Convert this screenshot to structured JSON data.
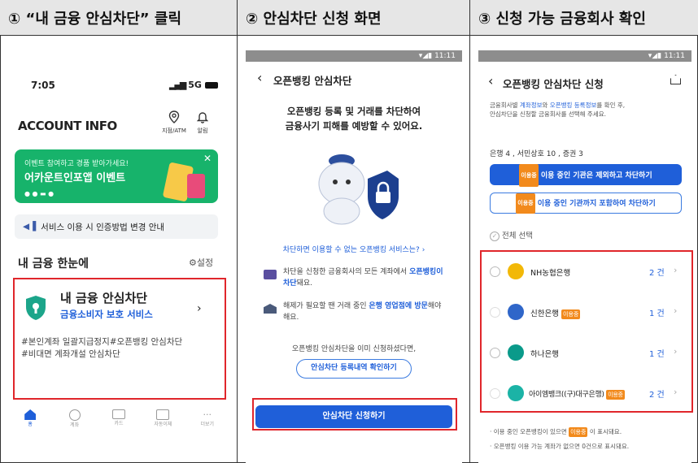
{
  "steps": [
    {
      "title": "① “내 금융 안심차단” 클릭"
    },
    {
      "title": "② 안심차단 신청 화면"
    },
    {
      "title": "③ 신청 가능 금융회사 확인"
    }
  ],
  "screen1": {
    "time": "7:05",
    "signal": "5G",
    "brand": "ACCOUNT INFO",
    "top_icons": [
      {
        "label": "지점/ATM",
        "icon": "location-pin-icon"
      },
      {
        "label": "알림",
        "icon": "bell-icon"
      }
    ],
    "banner": {
      "sub": "이벤트 참여하고 경품 받아가세요!",
      "title": "어카운트인포앱 이벤트"
    },
    "notice": "서비스 이용 시 인증방법 변경 안내",
    "section_title": "내 금융 한눈에",
    "settings_label": "설정",
    "card": {
      "title": "내 금융 안심차단",
      "subtitle": "금융소비자 보호 서비스",
      "tags": "#본인계좌 일괄지급정지#오픈뱅킹 안심차단\n#비대면 계좌개설 안심차단"
    },
    "tabs": [
      "홈",
      "계좌",
      "카드",
      "자동이체",
      "더보기"
    ]
  },
  "screen2": {
    "status": "11:11",
    "title": "오픈뱅킹 안심차단",
    "headline": "오픈뱅킹 등록 및 거래를 차단하여\n금융사기 피해를 예방할 수 있어요.",
    "link": "차단하면 이용할 수 없는 오픈뱅킹 서비스는?",
    "info1_pre": "차단을 신청한 금융회사의 모든 계좌에서 ",
    "info1_hl": "오픈뱅킹이 차단",
    "info1_post": "돼요.",
    "info2_pre": "해제가 필요할 땐 거래 중인 ",
    "info2_hl": "은행 영업점에 방문",
    "info2_post": "해야 해요.",
    "already": "오픈뱅킹 안심차단을 이미 신청하셨다면,",
    "history_btn": "안심차단 등록내역 확인하기",
    "apply_btn": "안심차단 신청하기"
  },
  "screen3": {
    "status": "11:11",
    "title": "오픈뱅킹 안심차단 신청",
    "desc_pre": "금융회사별 ",
    "desc_hl1": "계좌정보",
    "desc_mid": "와 ",
    "desc_hl2": "오픈뱅킹 등록정보",
    "desc_post": "를 확인 후,\n안심차단을 신청할 금융회사를 선택해 주세요.",
    "counts": "은행 4 , 서민상호 10 , 증권 3",
    "btn_exclude": "이용 중인 기관은 제외하고 차단하기",
    "btn_include": "이용 중인 기관까지 포함하여 차단하기",
    "select_all": "전체 선택",
    "tag_label": "이용중",
    "banks": [
      {
        "name": "NH농협은행",
        "count": "2 건",
        "color": "#f2b807",
        "tag": false
      },
      {
        "name": "신한은행",
        "count": "1 건",
        "color": "#2f66c9",
        "tag": true
      },
      {
        "name": "하나은행",
        "count": "1 건",
        "color": "#0a9a8a",
        "tag": false
      },
      {
        "name": "아이엠뱅크((구)대구은행)",
        "count": "2 건",
        "color": "#1bb3a6",
        "tag": true
      }
    ],
    "foot1_pre": "· 이용 중인 오픈뱅킹이 있으면 ",
    "foot1_post": " 이 표시돼요.",
    "foot2": "· 오픈뱅킹 이용 가능 계좌가 없으면 0건으로 표시돼요."
  }
}
